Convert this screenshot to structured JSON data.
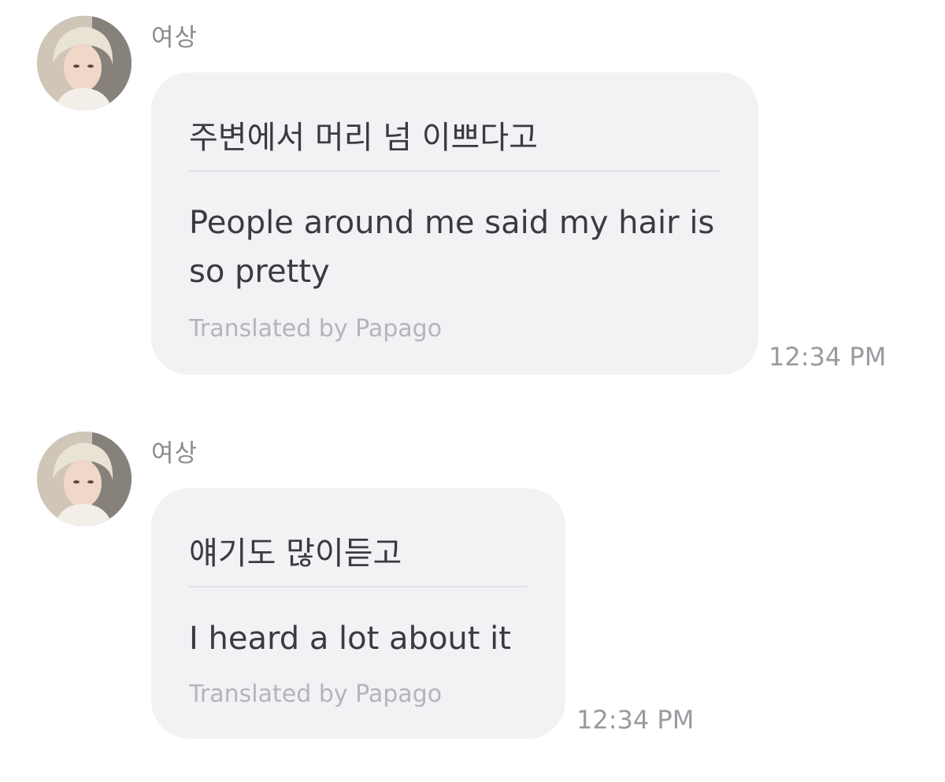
{
  "messages": [
    {
      "sender": "여상",
      "avatar_icon": "user-profile-photo",
      "original_text": "주변에서 머리 넘 이쁘다고",
      "translated_text": "People around me said my hair is so pretty",
      "credit": "Translated by Papago",
      "time": "12:34 PM"
    },
    {
      "sender": "여상",
      "avatar_icon": "user-profile-photo",
      "original_text": "얘기도 많이듣고",
      "translated_text": "I heard a lot about it",
      "credit": "Translated by Papago",
      "time": "12:34 PM"
    }
  ],
  "colors": {
    "bubble_background": "#f2f2f5",
    "divider": "#e1e1e5",
    "message_text": "#3a3a42",
    "credit_text": "#b4b4ba",
    "time_text": "#9a9aa0",
    "sender_text": "#8a8a90"
  }
}
